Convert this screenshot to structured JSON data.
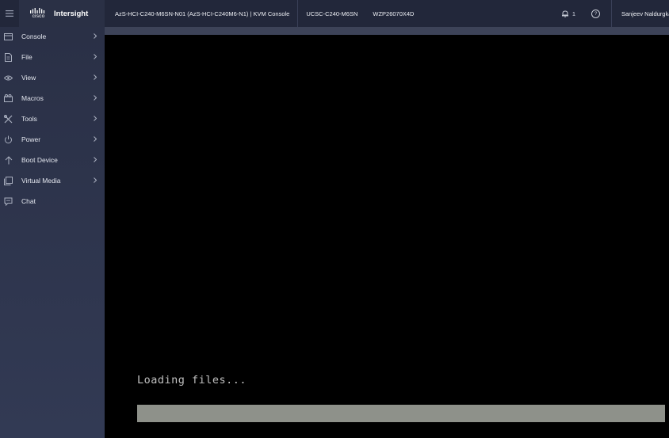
{
  "header": {
    "brand": {
      "logo_word": "cisco",
      "product": "Intersight"
    },
    "title": "AzS-HCI-C240-M6SN-N01 (AzS-HCI-C240M6-N1) | KVM Console",
    "model": "UCSC-C240-M6SN",
    "serial": "WZP26070X4D",
    "alarm_count": "1",
    "help_glyph": "?",
    "user": "Sanjeev Naldurgkar"
  },
  "sidebar": {
    "items": [
      {
        "label": "Console",
        "icon": "console-icon",
        "has_submenu": true
      },
      {
        "label": "File",
        "icon": "file-icon",
        "has_submenu": true
      },
      {
        "label": "View",
        "icon": "eye-icon",
        "has_submenu": true
      },
      {
        "label": "Macros",
        "icon": "macros-icon",
        "has_submenu": true
      },
      {
        "label": "Tools",
        "icon": "tools-icon",
        "has_submenu": true
      },
      {
        "label": "Power",
        "icon": "power-icon",
        "has_submenu": true
      },
      {
        "label": "Boot Device",
        "icon": "arrow-up-icon",
        "has_submenu": true
      },
      {
        "label": "Virtual Media",
        "icon": "virtual-media-icon",
        "has_submenu": true
      },
      {
        "label": "Chat",
        "icon": "chat-icon",
        "has_submenu": false
      }
    ]
  },
  "kvm": {
    "screen_text": "Loading files...",
    "progress_percent": 100
  },
  "colors": {
    "header_bg": "#22273a",
    "sidebar_bg": "#2a3046",
    "screen_bg": "#000000",
    "screen_text": "#c0c0c0",
    "progress_fill": "#8e918a"
  }
}
